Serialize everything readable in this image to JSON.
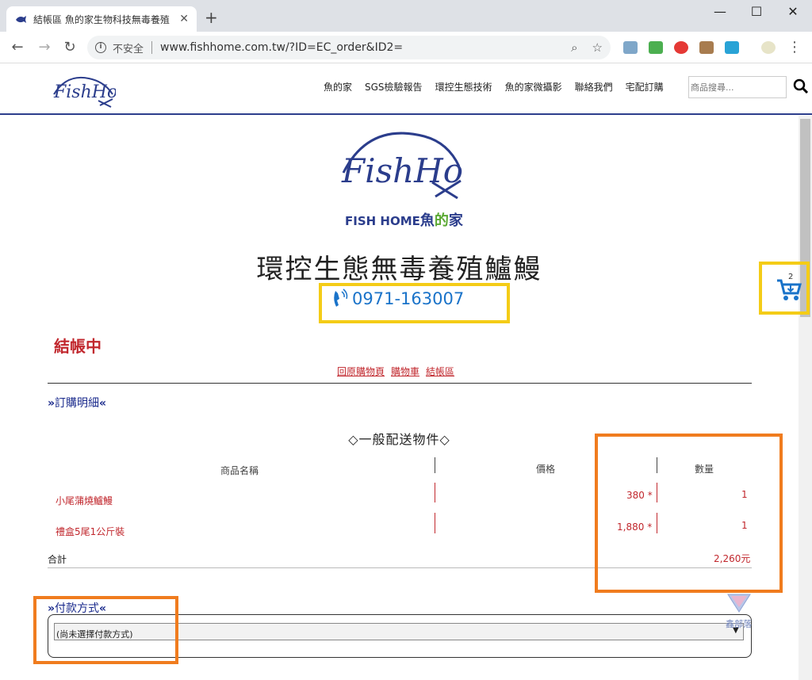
{
  "browser": {
    "tab_title": "結帳區 魚的家生物科技無毒養殖",
    "tab_close": "✕",
    "new_tab": "+",
    "minimize": "—",
    "maximize": "☐",
    "close": "✕",
    "insecure_label": "不安全",
    "url": "www.fishhome.com.tw/?ID=EC_order&ID2="
  },
  "header": {
    "nav": [
      "魚的家",
      "SGS檢驗報告",
      "環控生態技術",
      "魚的家微攝影",
      "聯絡我們",
      "宅配訂購"
    ],
    "search_placeholder": "商品搜尋..."
  },
  "brand": {
    "en": "FISH HOME",
    "cn_prefix": "魚",
    "cn_mid": "的",
    "cn_suffix": "家"
  },
  "page": {
    "title": "環控生態無毒養殖鱸鰻",
    "phone": "0971-163007",
    "cart_count": "2",
    "checkout_title": "結帳中",
    "crumbs": [
      "回原購物頁",
      "購物車",
      "結帳區"
    ]
  },
  "order": {
    "section_title": "訂購明細",
    "group_title": "◇一般配送物件◇",
    "columns": [
      "商品名稱",
      "價格",
      "數量"
    ],
    "rows": [
      {
        "name": "小尾蒲燒鱸鰻",
        "price": "380",
        "qty": "1"
      },
      {
        "name": "禮盒5尾1公斤裝",
        "price": "1,880",
        "qty": "1"
      }
    ],
    "price_suffix": "*",
    "total_label": "合計",
    "total_value": "2,260元"
  },
  "payment": {
    "section_title": "付款方式",
    "selected": "(尚未選擇付款方式)"
  },
  "watermark": "鑫部落",
  "colors": {
    "accent_red": "#c1272d",
    "brand_blue": "#2b3d8c",
    "highlight_yellow": "#f4cc17",
    "highlight_orange": "#f07c1e",
    "phone_blue": "#1a73c9"
  }
}
